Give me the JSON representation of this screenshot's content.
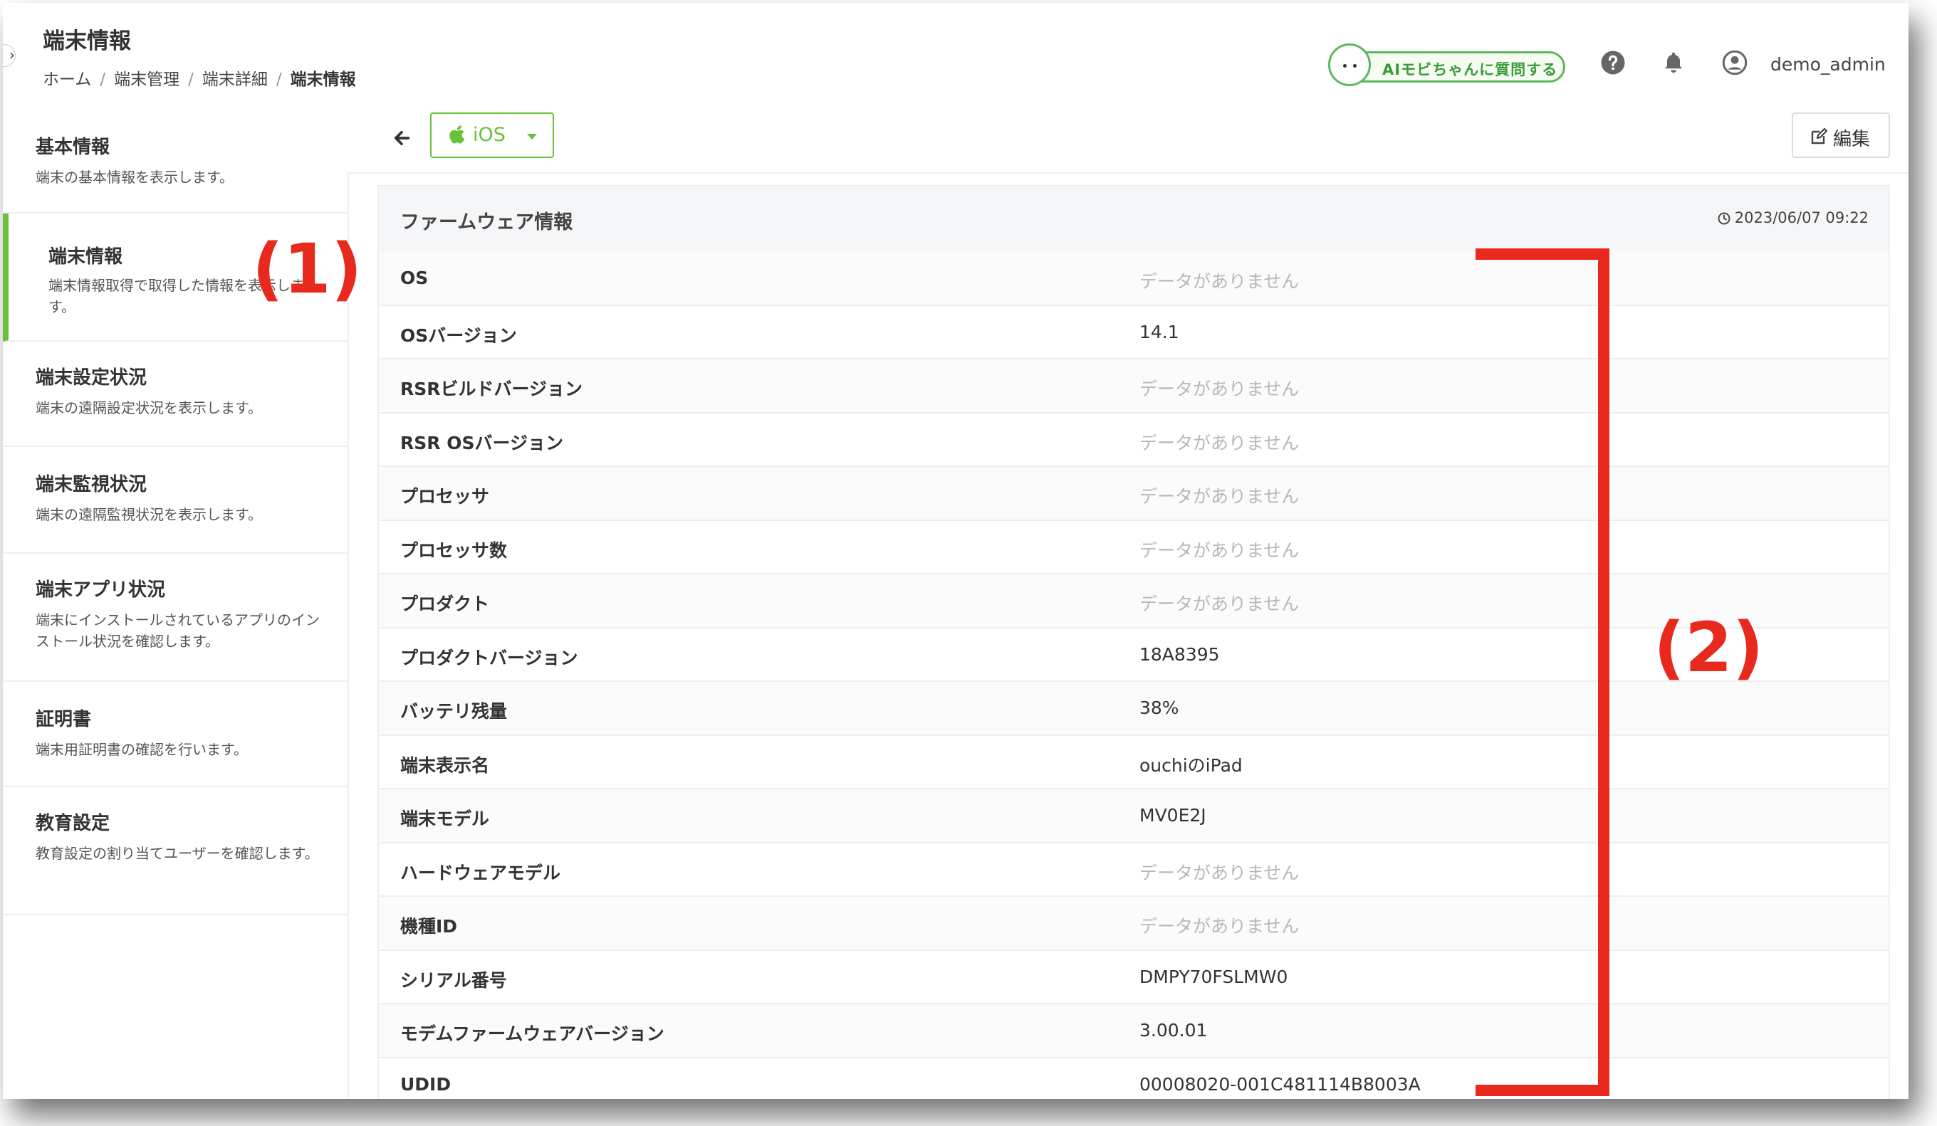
{
  "header": {
    "page_title": "端末情報",
    "breadcrumb": [
      "ホーム",
      "端末管理",
      "端末詳細",
      "端末情報"
    ],
    "ai_button_label": "AIモビちゃんに質問する",
    "username": "demo_admin"
  },
  "sidebar": {
    "items": [
      {
        "title": "基本情報",
        "desc": "端末の基本情報を表示します。"
      },
      {
        "title": "端末情報",
        "desc": "端末情報取得で取得した情報を表示します。"
      },
      {
        "title": "端末設定状況",
        "desc": "端末の遠隔設定状況を表示します。"
      },
      {
        "title": "端末監視状況",
        "desc": "端末の遠隔監視状況を表示します。"
      },
      {
        "title": "端末アプリ状況",
        "desc": "端末にインストールされているアプリのインストール状況を確認します。"
      },
      {
        "title": "証明書",
        "desc": "端末用証明書の確認を行います。"
      },
      {
        "title": "教育設定",
        "desc": "教育設定の割り当てユーザーを確認します。"
      }
    ]
  },
  "toolbar": {
    "os_select": "iOS",
    "edit_label": "編集"
  },
  "panel": {
    "title": "ファームウェア情報",
    "timestamp": "2023/06/07 09:22",
    "rows": [
      {
        "label": "OS",
        "value": "データがありません",
        "empty": true
      },
      {
        "label": "OSバージョン",
        "value": "14.1",
        "empty": false
      },
      {
        "label": "RSRビルドバージョン",
        "value": "データがありません",
        "empty": true
      },
      {
        "label": "RSR OSバージョン",
        "value": "データがありません",
        "empty": true
      },
      {
        "label": "プロセッサ",
        "value": "データがありません",
        "empty": true
      },
      {
        "label": "プロセッサ数",
        "value": "データがありません",
        "empty": true
      },
      {
        "label": "プロダクト",
        "value": "データがありません",
        "empty": true
      },
      {
        "label": "プロダクトバージョン",
        "value": "18A8395",
        "empty": false
      },
      {
        "label": "バッテリ残量",
        "value": "38%",
        "empty": false
      },
      {
        "label": "端末表示名",
        "value": "ouchiのiPad",
        "empty": false
      },
      {
        "label": "端末モデル",
        "value": "MV0E2J",
        "empty": false
      },
      {
        "label": "ハードウェアモデル",
        "value": "データがありません",
        "empty": true
      },
      {
        "label": "機種ID",
        "value": "データがありません",
        "empty": true
      },
      {
        "label": "シリアル番号",
        "value": "DMPY70FSLMW0",
        "empty": false
      },
      {
        "label": "モデムファームウェアバージョン",
        "value": "3.00.01",
        "empty": false
      },
      {
        "label": "UDID",
        "value": "00008020-001C481114B8003A",
        "empty": false
      }
    ]
  },
  "annotations": {
    "label_1": "(1)",
    "label_2": "(2)",
    "color": "#e82a1e"
  },
  "colors": {
    "accent": "#67c23a",
    "empty_value": "#b8b8b8"
  }
}
